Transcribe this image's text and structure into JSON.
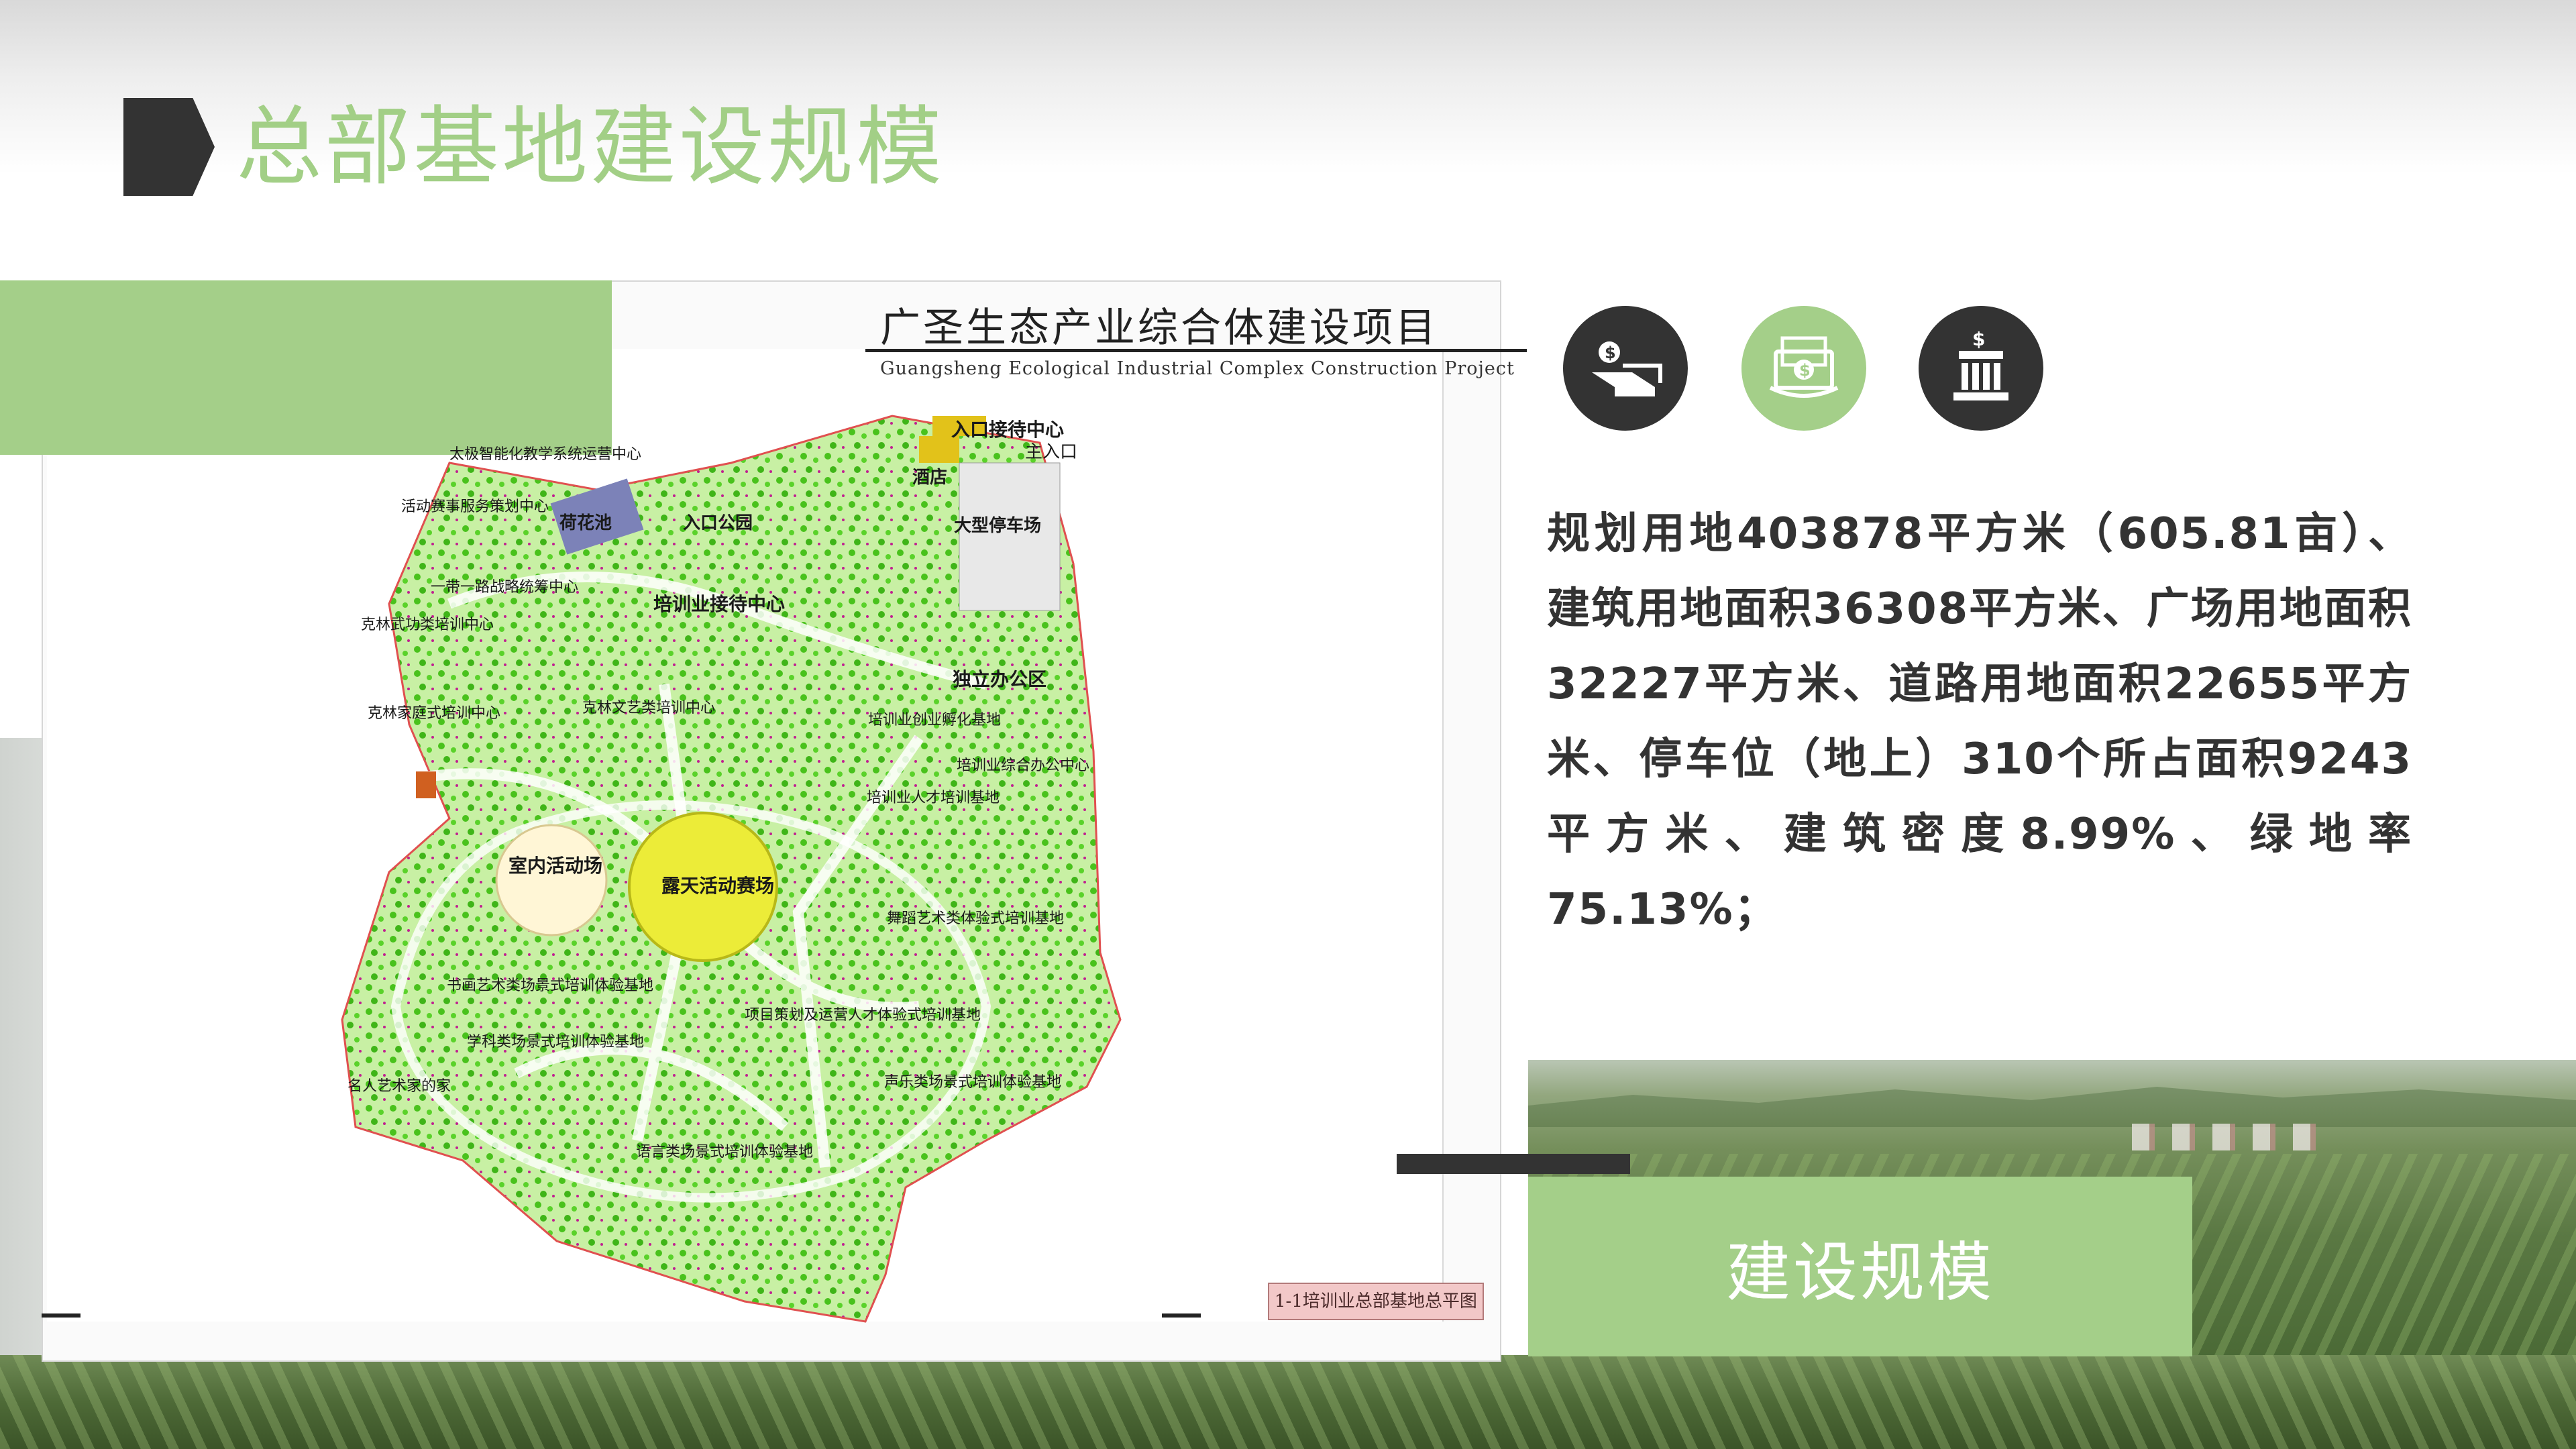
{
  "page": {
    "title": "总部基地建设规模",
    "accent_color": "#a4cf89",
    "dark_color": "#333333"
  },
  "plan": {
    "title_zh": "广圣生态产业综合体建设项目",
    "title_en": "Guangsheng Ecological Industrial Complex Construction Project",
    "caption": "1-1培训业总部基地总平图",
    "labels": {
      "entrance_reception": "入口接待中心",
      "main_entrance": "主入口",
      "hotel": "酒店",
      "taiji_center": "太极智能化教学系统运营中心",
      "event_planning": "活动赛事服务策划中心",
      "lotus_pond": "荷花池",
      "entrance_park": "入口公园",
      "parking": "大型停车场",
      "belt_road": "一带一路战略统筹中心",
      "training_reception": "培训业接待中心",
      "kungfu_center": "克林武功类培训中心",
      "independent_office": "独立办公区",
      "family_training": "克林家庭式培训中心",
      "art_training": "克林文艺类培训中心",
      "incubation": "培训业创业孵化基地",
      "complex_office": "培训业综合办公中心",
      "talent_base": "培训业人才培训基地",
      "indoor_venue": "室内活动场",
      "outdoor_arena": "露天活动赛场",
      "dance_base": "舞蹈艺术类体验式培训基地",
      "painting_base": "书画艺术类场景式培训体验基地",
      "project_planning": "项目策划及运营人才体验式培训基地",
      "science_base": "学科类场景式培训体验基地",
      "celebrity_home": "名人艺术家的家",
      "vocal_base": "声乐类场景式培训体验基地",
      "language_base": "语言类场景式培训体验基地"
    }
  },
  "icons": [
    "money-transfer-icon",
    "money-bill-icon",
    "bank-building-icon"
  ],
  "description": "规划用地403878平方米（605.81亩）、建筑用地面积36308平方米、广场用地面积32227平方米、道路用地面积22655平方米、停车位（地上）310个所占面积9243平方米、建筑密度8.99%、绿地率75.13%；",
  "label_box": {
    "text": "建设规模"
  }
}
